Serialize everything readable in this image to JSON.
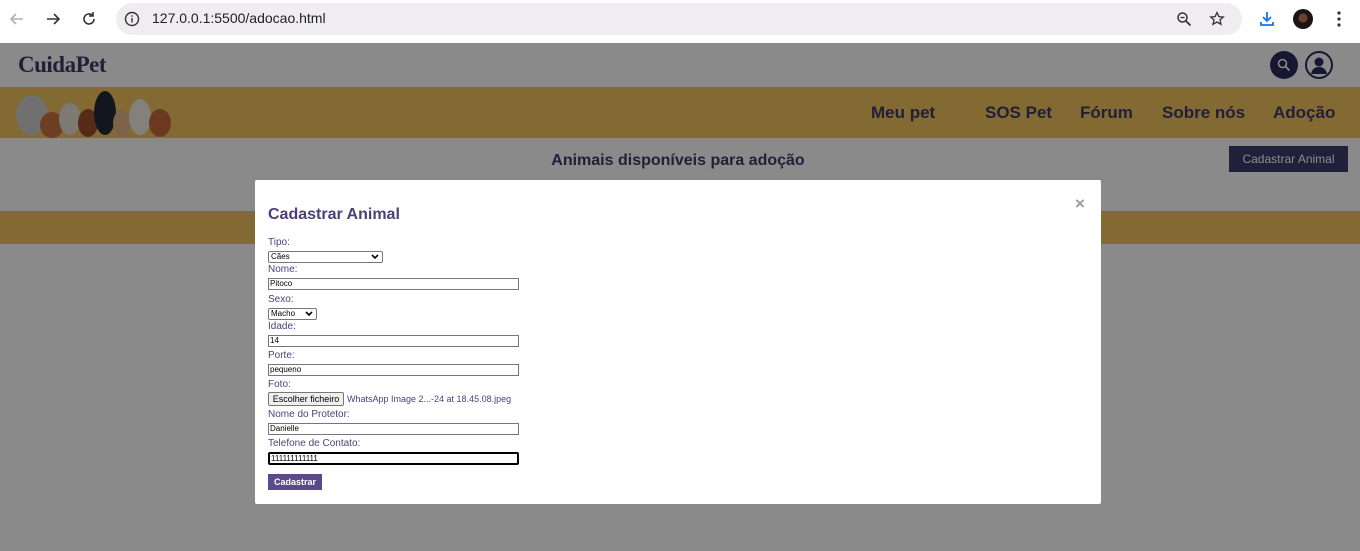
{
  "browser": {
    "url": "127.0.0.1:5500/adocao.html"
  },
  "site": {
    "logo": "CuidaPet",
    "nav": [
      "Meu pet",
      "SOS Pet",
      "Fórum",
      "Sobre nós",
      "Adoção"
    ]
  },
  "page": {
    "title": "Animais disponíveis para adoção",
    "register_button": "Cadastrar Animal"
  },
  "modal": {
    "title": "Cadastrar Animal",
    "close": "×",
    "fields": {
      "tipo": {
        "label": "Tipo:",
        "value": "Cães"
      },
      "nome": {
        "label": "Nome:",
        "value": "Pitoco"
      },
      "sexo": {
        "label": "Sexo:",
        "value": "Macho"
      },
      "idade": {
        "label": "Idade:",
        "value": "14"
      },
      "porte": {
        "label": "Porte:",
        "value": "pequeno"
      },
      "foto": {
        "label": "Foto:",
        "button": "Escolher ficheiro",
        "file": "WhatsApp Image 2...-24 at 18.45.08.jpeg"
      },
      "protetor": {
        "label": "Nome do Protetor:",
        "value": "Danielle"
      },
      "telefone": {
        "label": "Telefone de Contato:",
        "value": "111111111111"
      }
    },
    "submit": "Cadastrar"
  },
  "colors": {
    "brand": "#3d3b6b",
    "banner": "#f2c35d",
    "button": "#5b4a8a"
  }
}
